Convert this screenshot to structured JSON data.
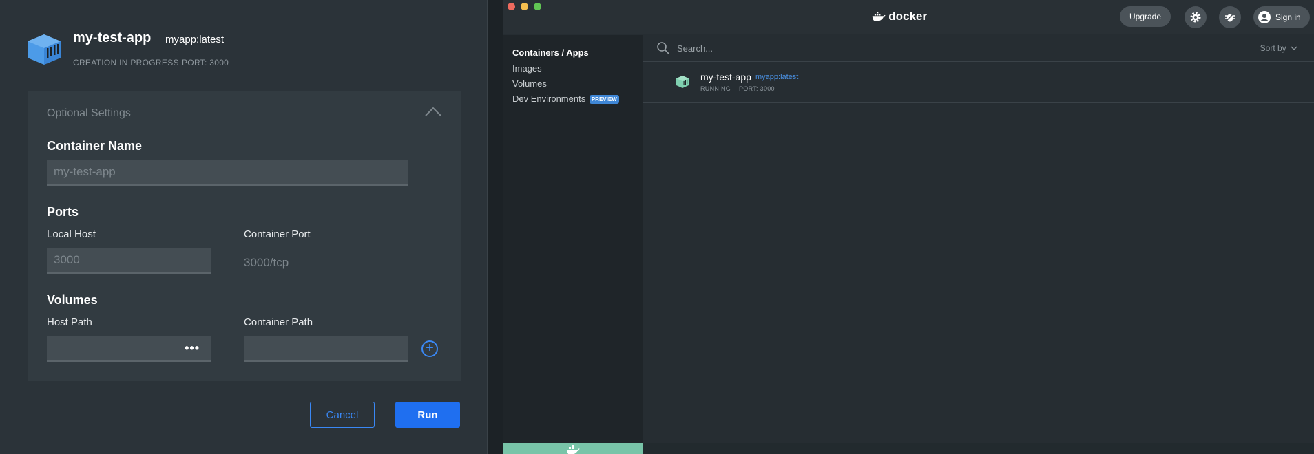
{
  "dialog": {
    "app_name": "my-test-app",
    "image": "myapp:latest",
    "status": "CREATION IN PROGRESS",
    "port_meta": "PORT: 3000",
    "optional_settings": {
      "title": "Optional Settings",
      "container_name": {
        "label": "Container Name",
        "placeholder": "my-test-app"
      },
      "ports": {
        "title": "Ports",
        "local_host_label": "Local Host",
        "local_host_placeholder": "3000",
        "container_port_label": "Container Port",
        "container_port_value": "3000/tcp"
      },
      "volumes": {
        "title": "Volumes",
        "host_path_label": "Host Path",
        "container_path_label": "Container Path",
        "browse_label": "•••",
        "add_label": "+"
      }
    },
    "cancel_label": "Cancel",
    "run_label": "Run"
  },
  "docker": {
    "logo_text": "docker",
    "upgrade_label": "Upgrade",
    "signin_label": "Sign in",
    "sidebar": {
      "items": [
        {
          "label": "Containers / Apps"
        },
        {
          "label": "Images"
        },
        {
          "label": "Volumes"
        },
        {
          "label": "Dev Environments"
        }
      ],
      "preview_badge": "PREVIEW"
    },
    "search": {
      "placeholder": "Search..."
    },
    "sort_label": "Sort by",
    "containers": [
      {
        "name": "my-test-app",
        "image": "myapp:latest",
        "status": "RUNNING",
        "port": "PORT: 3000"
      }
    ]
  },
  "colors": {
    "accent": "#1f6ff0",
    "link": "#4a90e2",
    "cube": "#4c9be8",
    "running_cube": "#7fd0b0",
    "traffic_red": "#ed6a5e",
    "traffic_yellow": "#f5bf4f",
    "traffic_green": "#61c554"
  }
}
